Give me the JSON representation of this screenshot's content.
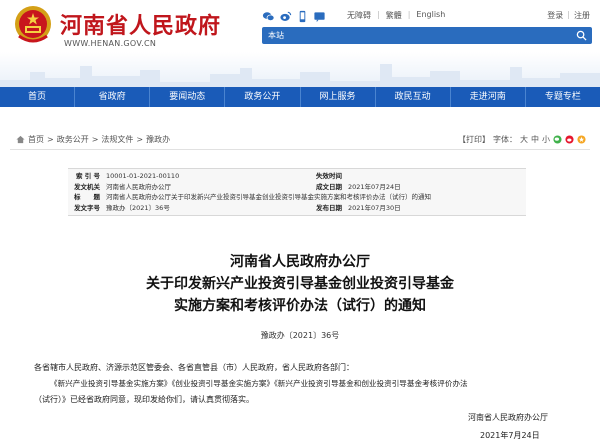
{
  "header": {
    "site_title": "河南省人民政府",
    "site_domain": "WWW.HENAN.GOV.CN",
    "accessibility": "无障碍",
    "traditional": "繁體",
    "english": "English",
    "login": "登录",
    "register": "注册",
    "search_scope": "本站",
    "search_placeholder": ""
  },
  "nav": {
    "items": [
      "首页",
      "省政府",
      "要闻动态",
      "政务公开",
      "网上服务",
      "政民互动",
      "走进河南",
      "专题专栏"
    ]
  },
  "breadcrumb": {
    "items": [
      "首页",
      "政务公开",
      "法规文件",
      "豫政办"
    ],
    "separator": ">"
  },
  "tools": {
    "print": "【打印】",
    "font_label": "字体：",
    "font_large": "大",
    "font_medium": "中",
    "font_small": "小"
  },
  "meta": {
    "index_k": "索 引 号",
    "index_v": "10001-01-2021-00110",
    "validity_k": "失效时间",
    "validity_v": "",
    "issuer_k": "发文机关",
    "issuer_v": "河南省人民政府办公厅",
    "date_k": "成文日期",
    "date_v": "2021年07月24日",
    "title_k": "标　　题",
    "title_v": "河南省人民政府办公厅关于印发新兴产业投资引导基金创业投资引导基金实施方案和考核评价办法（试行）的通知",
    "docno_k": "发文字号",
    "docno_v": "豫政办〔2021〕36号",
    "pub_k": "发布日期",
    "pub_v": "2021年07月30日"
  },
  "document": {
    "title_line1": "河南省人民政府办公厅",
    "title_line2": "关于印发新兴产业投资引导基金创业投资引导基金",
    "title_line3": "实施方案和考核评价办法（试行）的通知",
    "number": "豫政办〔2021〕36号",
    "salutation": "各省辖市人民政府、济源示范区管委会、各省直管县（市）人民政府，省人民政府各部门：",
    "body_line1": "《新兴产业投资引导基金实施方案》《创业投资引导基金实施方案》《新兴产业投资引导基金和创业投资引导基金考核评价办法",
    "body_line2": "（试行）》已经省政府同意，现印发给你们，请认真贯彻落实。",
    "signature": "河南省人民政府办公厅",
    "sign_date": "2021年7月24日"
  },
  "colors": {
    "title_red": "#c0161c",
    "nav_blue": "#1a5bb8",
    "search_blue": "#2a6cbe"
  }
}
